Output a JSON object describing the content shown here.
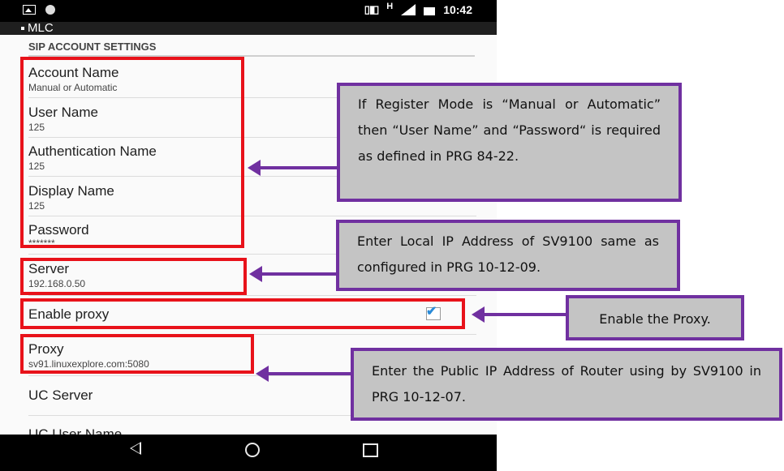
{
  "statusbar": {
    "time": "10:42",
    "network": "H"
  },
  "appbar": {
    "title": "MLC"
  },
  "section": {
    "title": "SIP ACCOUNT SETTINGS"
  },
  "settings": [
    {
      "label": "Account Name",
      "value": "Manual or Automatic"
    },
    {
      "label": "User Name",
      "value": "125"
    },
    {
      "label": "Authentication Name",
      "value": "125"
    },
    {
      "label": "Display Name",
      "value": "125"
    },
    {
      "label": "Password",
      "value": "*******"
    },
    {
      "label": "Server",
      "value": "192.168.0.50"
    },
    {
      "label": "Enable proxy",
      "value": ""
    },
    {
      "label": "Proxy",
      "value": "sv91.linuxexplore.com:5080"
    },
    {
      "label": "UC Server",
      "value": ""
    },
    {
      "label": "UC User Name",
      "value": ""
    }
  ],
  "proxy_enabled": true,
  "callouts": [
    {
      "text": "If Register Mode is “Manual or Automatic” then “User Name” and “Password“ is required as defined in PRG 84-22."
    },
    {
      "text": "Enter Local IP Address of SV9100 same as configured in PRG 10-12-09."
    },
    {
      "text": "Enable the Proxy."
    },
    {
      "text": "Enter the Public IP Address of Router using by SV9100 in PRG 10-12-07."
    }
  ],
  "colors": {
    "highlight_box": "#e8121a",
    "callout_border": "#7030a0",
    "callout_fill": "#c4c4c4",
    "checkbox_check": "#2a8bd8"
  }
}
